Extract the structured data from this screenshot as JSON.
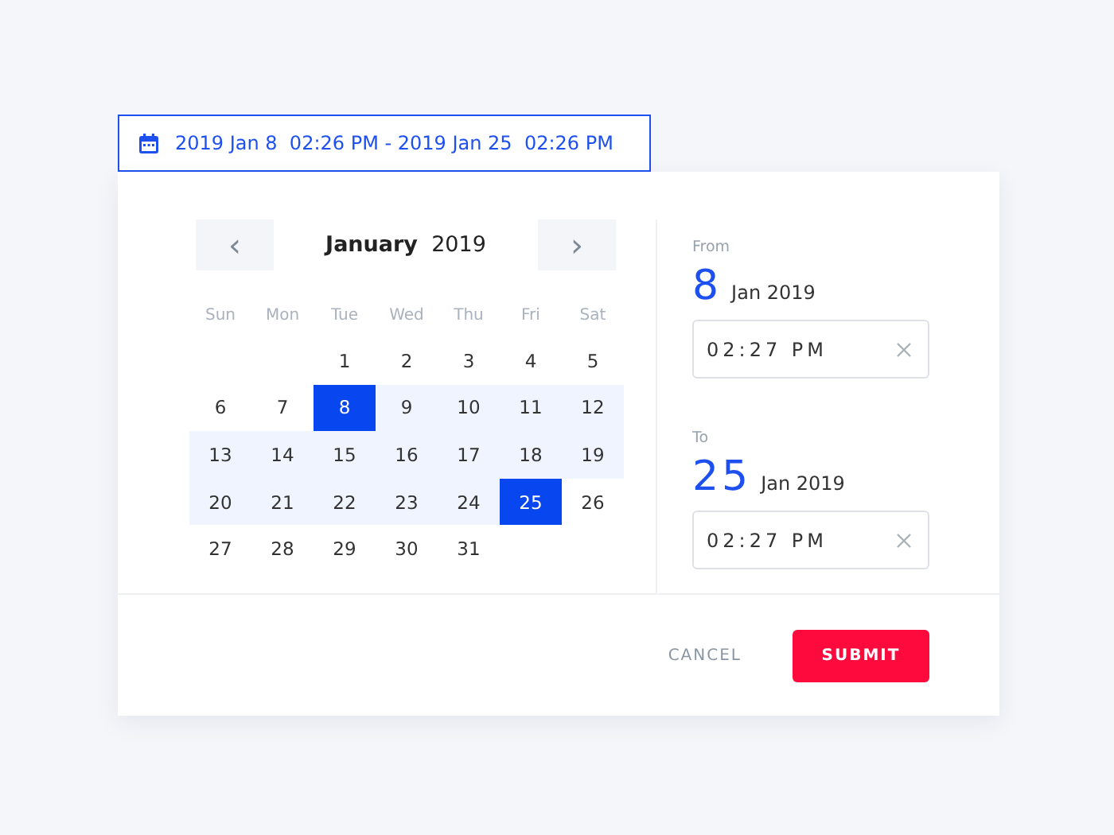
{
  "range_field": {
    "value": "2019 Jan 8  02:26 PM - 2019 Jan 25  02:26 PM"
  },
  "calendar": {
    "prev": "‹",
    "next": "›",
    "month": "January",
    "year": "2019",
    "weekdays": [
      "Sun",
      "Mon",
      "Tue",
      "Wed",
      "Thu",
      "Fri",
      "Sat"
    ],
    "days": [
      {
        "kind": "blank"
      },
      {
        "kind": "blank"
      },
      {
        "kind": "day",
        "label": "1",
        "selected": false,
        "in_range": false
      },
      {
        "kind": "day",
        "label": "2",
        "selected": false,
        "in_range": false
      },
      {
        "kind": "day",
        "label": "3",
        "selected": false,
        "in_range": false
      },
      {
        "kind": "day",
        "label": "4",
        "selected": false,
        "in_range": false
      },
      {
        "kind": "day",
        "label": "5",
        "selected": false,
        "in_range": false
      },
      {
        "kind": "day",
        "label": "6",
        "selected": false,
        "in_range": false
      },
      {
        "kind": "day",
        "label": "7",
        "selected": false,
        "in_range": false
      },
      {
        "kind": "day",
        "label": "8",
        "selected": true,
        "in_range": true
      },
      {
        "kind": "day",
        "label": "9",
        "selected": false,
        "in_range": true
      },
      {
        "kind": "day",
        "label": "10",
        "selected": false,
        "in_range": true
      },
      {
        "kind": "day",
        "label": "11",
        "selected": false,
        "in_range": true
      },
      {
        "kind": "day",
        "label": "12",
        "selected": false,
        "in_range": true
      },
      {
        "kind": "day",
        "label": "13",
        "selected": false,
        "in_range": true
      },
      {
        "kind": "day",
        "label": "14",
        "selected": false,
        "in_range": true
      },
      {
        "kind": "day",
        "label": "15",
        "selected": false,
        "in_range": true
      },
      {
        "kind": "day",
        "label": "16",
        "selected": false,
        "in_range": true
      },
      {
        "kind": "day",
        "label": "17",
        "selected": false,
        "in_range": true
      },
      {
        "kind": "day",
        "label": "18",
        "selected": false,
        "in_range": true
      },
      {
        "kind": "day",
        "label": "19",
        "selected": false,
        "in_range": true
      },
      {
        "kind": "day",
        "label": "20",
        "selected": false,
        "in_range": true
      },
      {
        "kind": "day",
        "label": "21",
        "selected": false,
        "in_range": true
      },
      {
        "kind": "day",
        "label": "22",
        "selected": false,
        "in_range": true
      },
      {
        "kind": "day",
        "label": "23",
        "selected": false,
        "in_range": true
      },
      {
        "kind": "day",
        "label": "24",
        "selected": false,
        "in_range": true
      },
      {
        "kind": "day",
        "label": "25",
        "selected": true,
        "in_range": true
      },
      {
        "kind": "day",
        "label": "26",
        "selected": false,
        "in_range": false
      },
      {
        "kind": "day",
        "label": "27",
        "selected": false,
        "in_range": false
      },
      {
        "kind": "day",
        "label": "28",
        "selected": false,
        "in_range": false
      },
      {
        "kind": "day",
        "label": "29",
        "selected": false,
        "in_range": false
      },
      {
        "kind": "day",
        "label": "30",
        "selected": false,
        "in_range": false
      },
      {
        "kind": "day",
        "label": "31",
        "selected": false,
        "in_range": false
      }
    ]
  },
  "from": {
    "label": "From",
    "day": "8",
    "month_year": "Jan 2019",
    "time": "02:27 PM"
  },
  "to": {
    "label": "To",
    "day": "25",
    "month_year": "Jan 2019",
    "time": "02:27 PM"
  },
  "buttons": {
    "cancel": "CANCEL",
    "submit": "SUBMIT"
  }
}
